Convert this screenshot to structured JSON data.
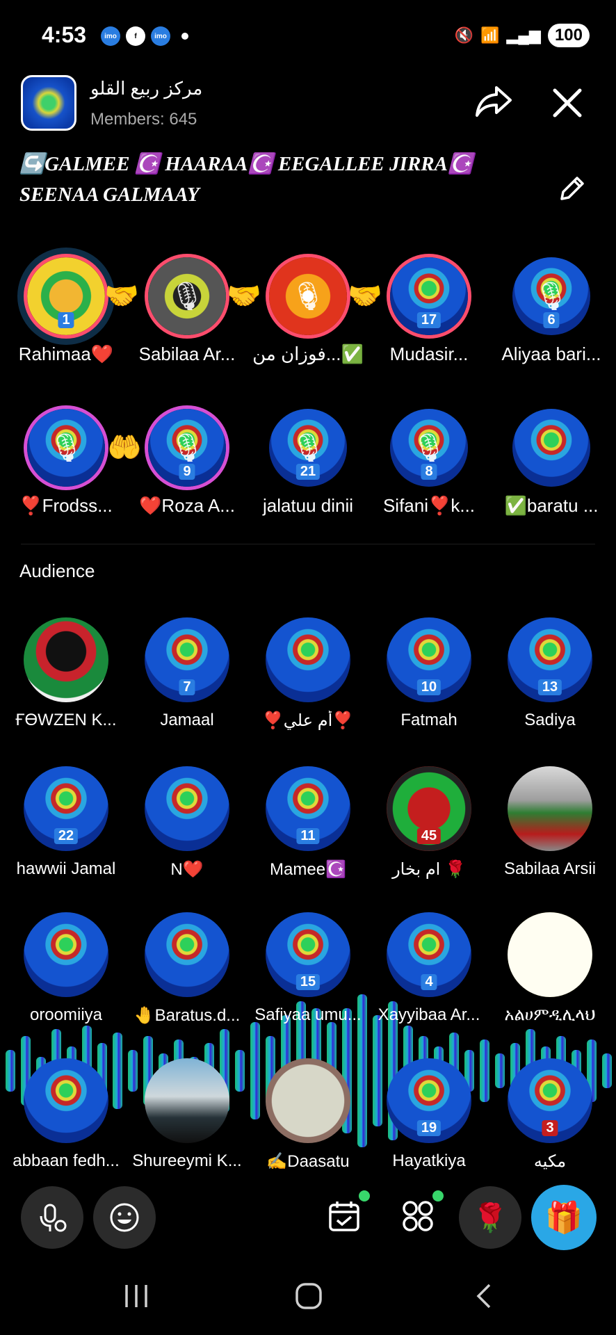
{
  "status": {
    "time": "4:53",
    "left_icons": [
      "imo-icon",
      "facebook-icon",
      "imo-icon"
    ],
    "battery": "100"
  },
  "room": {
    "name": "مركز ربيع القلو",
    "members": "Members: 645",
    "announcement_line1": "↪️GALMEE ☪️ HAARAA☪️ EEGALLEE JIRRA☪️",
    "announcement_line2": "SEENAA GALMAAY"
  },
  "seats": [
    {
      "label": "Rahimaa❤️",
      "num": "1"
    },
    {
      "label": "Sabilaa Ar...",
      "num": ""
    },
    {
      "label": "فوزان من...✅",
      "num": ""
    },
    {
      "label": "Mudasir...",
      "num": "17"
    },
    {
      "label": "Aliyaa bari...",
      "num": "6"
    },
    {
      "label": "❣️Frodss...",
      "num": ""
    },
    {
      "label": "❤️Roza A...",
      "num": "9"
    },
    {
      "label": "jalatuu dinii",
      "num": "21"
    },
    {
      "label": "Sifani❣️k...",
      "num": "8"
    },
    {
      "label": "✅baratu ...",
      "num": ""
    }
  ],
  "audience_title": "Audience",
  "audience": [
    {
      "label": "ҒӨWZEN K...",
      "num": ""
    },
    {
      "label": "Jamaal",
      "num": "7"
    },
    {
      "label": "❣️أم علي❣️",
      "num": ""
    },
    {
      "label": "Fatmah",
      "num": "10"
    },
    {
      "label": "Sadiya",
      "num": "13"
    },
    {
      "label": "hawwii Jamal",
      "num": "22"
    },
    {
      "label": "N❤️",
      "num": ""
    },
    {
      "label": "Mamee☪️",
      "num": "11"
    },
    {
      "label": "ام بخار 🌹",
      "num": "45"
    },
    {
      "label": "Sabilaa Arsii",
      "num": ""
    },
    {
      "label": "oroomiiya",
      "num": ""
    },
    {
      "label": "🤚Baratus.d...",
      "num": ""
    },
    {
      "label": "Safiyaa umu...",
      "num": "15"
    },
    {
      "label": "Xayyibaa Ar...",
      "num": "4"
    },
    {
      "label": "አልሀምዲሊላህ",
      "num": ""
    },
    {
      "label": "abbaan fedh...",
      "num": ""
    },
    {
      "label": "Shureeymi K...",
      "num": ""
    },
    {
      "label": "✍️Daasatu",
      "num": ""
    },
    {
      "label": "Hayatkiya",
      "num": "19"
    },
    {
      "label": "مكيه",
      "num": "3"
    }
  ],
  "colors": {
    "accent": "#2aa7e6",
    "ring": "#ff4d6d",
    "badge": "#38d66b"
  }
}
